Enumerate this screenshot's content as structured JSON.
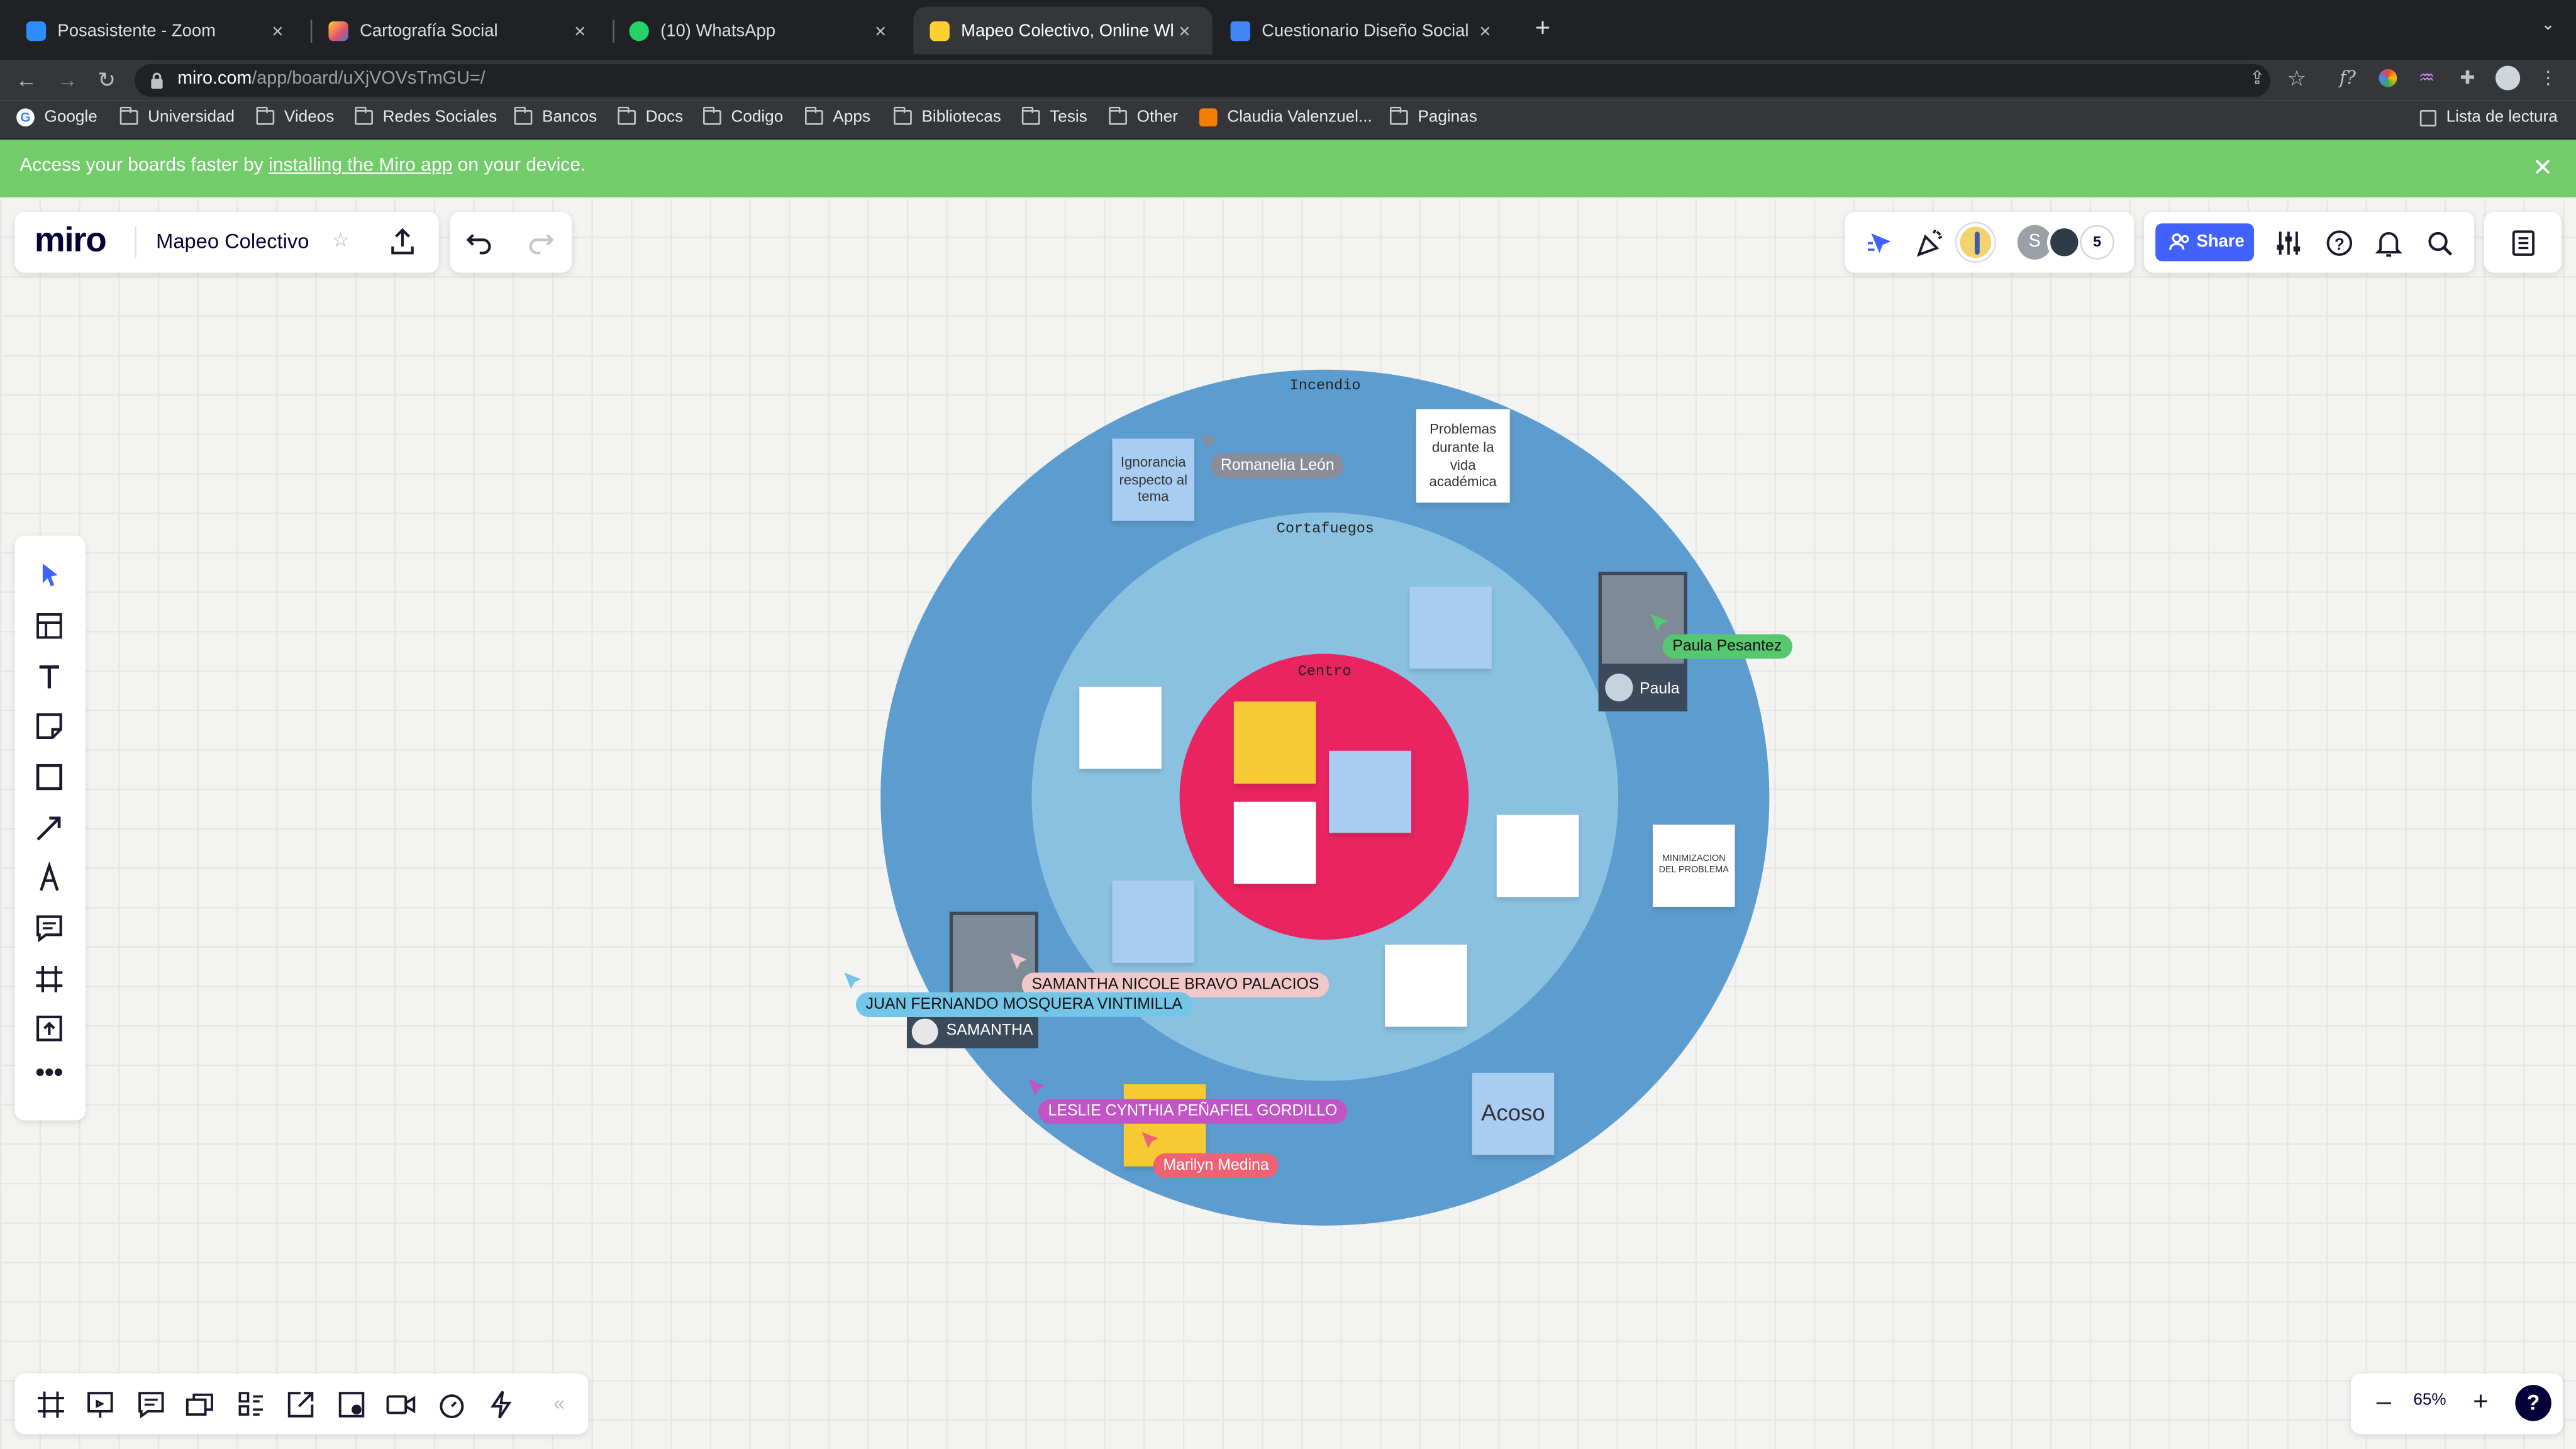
{
  "browser": {
    "tabs": [
      {
        "title": "Posasistente - Zoom",
        "icon": "zoom-icon",
        "color": "#2d8cff"
      },
      {
        "title": "Cartografía Social",
        "icon": "cartografia-icon",
        "color": "#e34f6b"
      },
      {
        "title": "(10) WhatsApp",
        "icon": "whatsapp-icon",
        "color": "#25d366"
      },
      {
        "title": "Mapeo Colectivo, Online Whiteb",
        "icon": "miro-icon",
        "color": "#ffd02f"
      },
      {
        "title": "Cuestionario Diseño Social - D",
        "icon": "docs-icon",
        "color": "#4285f4"
      }
    ],
    "url_domain": "miro.com",
    "url_path": "/app/board/uXjVOVsTmGU=/",
    "bookmarks": [
      "Google",
      "Universidad",
      "Videos",
      "Redes Sociales",
      "Bancos",
      "Docs",
      "Codigo",
      "Apps",
      "Bibliotecas",
      "Tesis",
      "Other",
      "Claudia Valenzuel...",
      "Paginas"
    ],
    "reading_list": "Lista de lectura"
  },
  "banner": {
    "prefix": "Access your boards faster by ",
    "link": "installing the Miro app",
    "suffix": " on your device."
  },
  "board": {
    "logo": "miro",
    "title": "Mapeo Colectivo",
    "share_label": "Share",
    "collaborator_count": "5",
    "avatar_initial": "S",
    "zoom": "65%"
  },
  "map": {
    "rings": {
      "outer": "Incendio",
      "middle": "Cortafuegos",
      "center": "Centro"
    },
    "stickies": {
      "ignorancia": "Ignorancia respecto al tema",
      "problemas": "Problemas durante la vida académica",
      "minimizacion": "MINIMIZACION DEL PROBLEMA",
      "acoso": "Acoso"
    },
    "cursors": [
      {
        "name": "Romanelia León",
        "color": "#8a8d98"
      },
      {
        "name": "Paula Pesantez",
        "color": "#56c86f"
      },
      {
        "name": "SAMANTHA NICOLE BRAVO PALACIOS",
        "color": "#f2c7c9"
      },
      {
        "name": "JUAN FERNANDO MOSQUERA VINTIMILLA",
        "color": "#73c6e8"
      },
      {
        "name": "LESLIE CYNTHIA PEÑAFIEL GORDILLO",
        "color": "#c255c6"
      },
      {
        "name": "Marilyn Medina",
        "color": "#f06273"
      }
    ],
    "video_tiles": [
      {
        "name": "Paula"
      },
      {
        "name": "SAMANTHA"
      }
    ]
  },
  "colors": {
    "outer_ring": "#5d9cce",
    "middle_ring": "#8ac0e0",
    "center": "#ea2460",
    "banner": "#72cc6a",
    "accent": "#4262ff"
  }
}
